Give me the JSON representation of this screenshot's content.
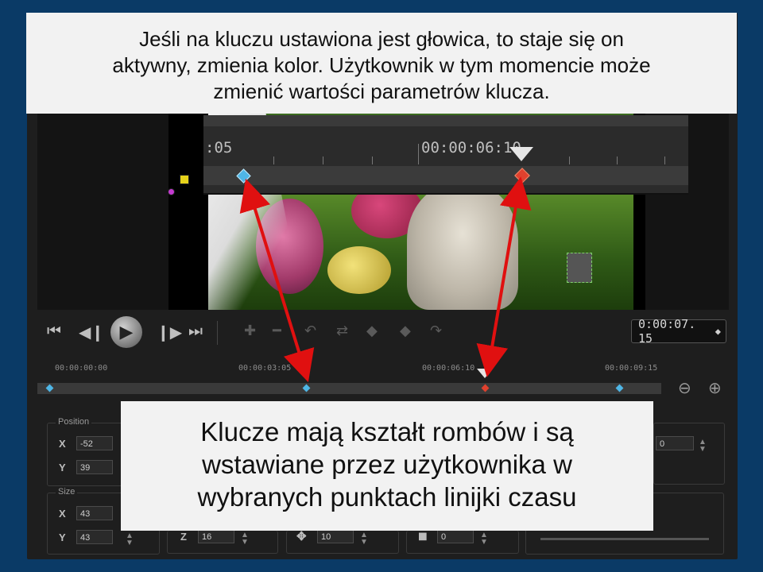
{
  "callouts": {
    "top_lines": [
      "Jeśli na kluczu ustawiona jest głowica, to staje się on",
      "aktywny, zmienia kolor. Użytkownik w tym momencie może",
      "zmienić wartości parametrów klucza."
    ],
    "bottom_lines": [
      "Klucze mają kształt rombów i są",
      "wstawiane przez użytkownika w",
      "wybranych punktach linijki czasu"
    ]
  },
  "zoom_panel": {
    "ruler_left": ":05",
    "ruler_mid": "00:00:06:10"
  },
  "transport": {
    "timecode": "0:00:07. 15"
  },
  "timeline": {
    "labels": [
      "00:00:00:00",
      "00:00:03:05",
      "00:00:06:10",
      "00:00:09:15"
    ]
  },
  "properties": {
    "position": {
      "title": "Position",
      "x_label": "X",
      "x_value": "-52",
      "y_label": "Y",
      "y_value": "39"
    },
    "size": {
      "title": "Size",
      "x_label": "X",
      "x_value": "43",
      "y_label": "Y",
      "y_value": "43"
    },
    "z": {
      "label": "Z",
      "value": "16"
    },
    "move": {
      "value": "10"
    },
    "border": {
      "value": "0"
    },
    "right": {
      "value": "0"
    }
  },
  "colors": {
    "annotation_arrow": "#e01010",
    "keyframe_diamond": "#4fb6e6",
    "active_keyframe": "#e0412e",
    "background": "#0a3a66"
  },
  "icons": {
    "go_start": "go-to-start-icon",
    "prev_frame": "previous-frame-icon",
    "play": "play-icon",
    "next_frame": "next-frame-icon",
    "go_end": "go-to-end-icon",
    "zoom_out": "zoom-out-icon",
    "zoom_in": "zoom-in-icon"
  }
}
